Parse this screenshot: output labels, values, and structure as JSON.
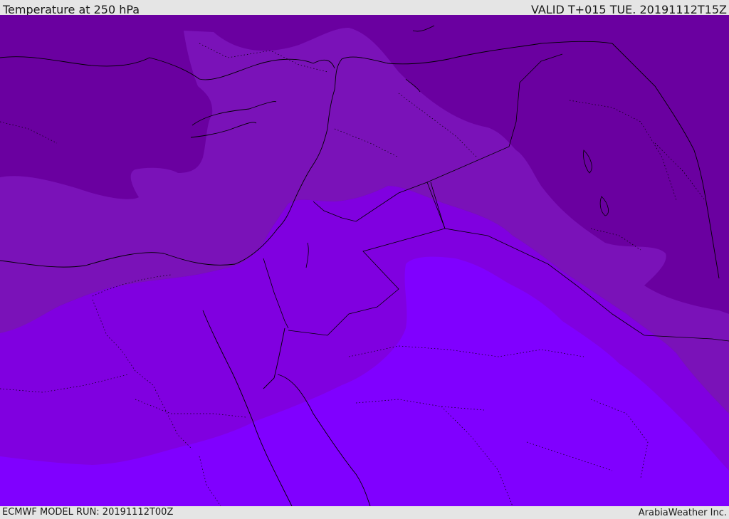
{
  "header": {
    "title": "Temperature at 250 hPa",
    "valid_time": "VALID T+015 TUE. 20191112T15Z"
  },
  "footer": {
    "model_run": "ECMWF MODEL RUN: 20191112T00Z",
    "credit": "ArabiaWeather Inc."
  },
  "map": {
    "colors": {
      "coldest": "#6a00a0",
      "cold": "#7a12b8",
      "mild": "#8000e0",
      "warm": "#8000ff"
    }
  }
}
